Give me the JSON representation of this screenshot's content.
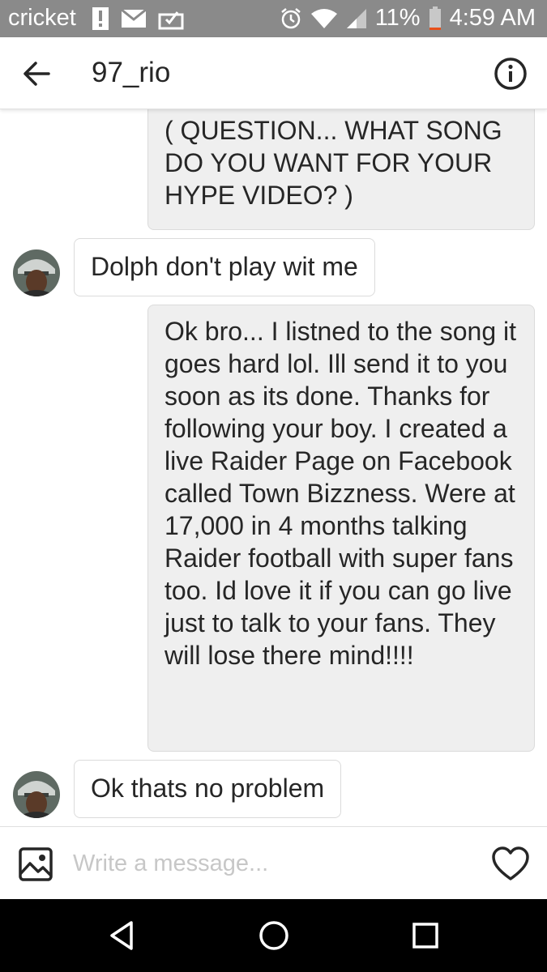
{
  "status_bar": {
    "carrier": "cricket",
    "battery_percent": "11%",
    "time": "4:59 AM"
  },
  "header": {
    "title": "97_rio"
  },
  "messages": [
    {
      "direction": "outgoing",
      "text": "( QUESTION... WHAT SONG DO YOU WANT FOR YOUR HYPE VIDEO? )"
    },
    {
      "direction": "incoming",
      "text": "Dolph don't play wit me"
    },
    {
      "direction": "outgoing",
      "text": "Ok bro... I listned to the song it goes hard lol. Ill send it to you soon as its done. Thanks for following your boy. I created a live Raider Page on Facebook called Town Bizzness. Were at 17,000 in 4 months talking Raider football with super fans too. Id love it if you can go live just to talk to your fans. They will lose there mind!!!!"
    },
    {
      "direction": "incoming",
      "text": "Ok thats no problem"
    }
  ],
  "composer": {
    "placeholder": "Write a message..."
  },
  "colors": {
    "status_bar": "#8a8a8a",
    "outgoing_bubble": "#efefef",
    "bubble_border": "#dbdbdb",
    "text": "#262626",
    "battery_low": "#e8501a",
    "nav_bar": "#000000"
  },
  "icons": {
    "back": "arrow-left-icon",
    "info": "info-circle-icon",
    "gallery": "image-icon",
    "like": "heart-icon"
  }
}
